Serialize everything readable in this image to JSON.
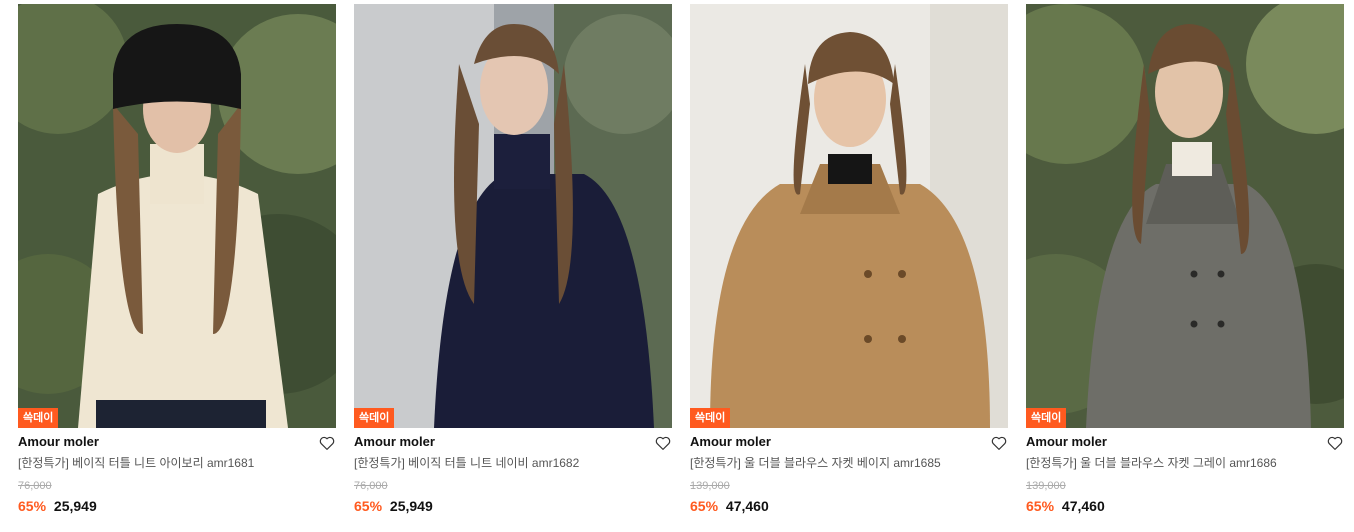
{
  "products": [
    {
      "badge": "쓱데이",
      "brand": "Amour moler",
      "title": "[한정특가] 베이직 터틀 니트 아이보리 amr1681",
      "original_price": "76,000",
      "discount_rate": "65%",
      "sale_price": "25,949",
      "icon": "heart-outline-icon"
    },
    {
      "badge": "쓱데이",
      "brand": "Amour moler",
      "title": "[한정특가] 베이직 터틀 니트 네이비 amr1682",
      "original_price": "76,000",
      "discount_rate": "65%",
      "sale_price": "25,949",
      "icon": "heart-outline-icon"
    },
    {
      "badge": "쓱데이",
      "brand": "Amour moler",
      "title": "[한정특가] 울 더블 블라우스 자켓 베이지 amr1685",
      "original_price": "139,000",
      "discount_rate": "65%",
      "sale_price": "47,460",
      "icon": "heart-outline-icon"
    },
    {
      "badge": "쓱데이",
      "brand": "Amour moler",
      "title": "[한정특가] 울 더블 블라우스 자켓 그레이 amr1686",
      "original_price": "139,000",
      "discount_rate": "65%",
      "sale_price": "47,460",
      "icon": "heart-outline-icon"
    }
  ],
  "colors": {
    "accent": "#ff5a1f",
    "badge_text": "#ffffff",
    "price": "#111111",
    "strikethrough": "#aaaaaa"
  }
}
